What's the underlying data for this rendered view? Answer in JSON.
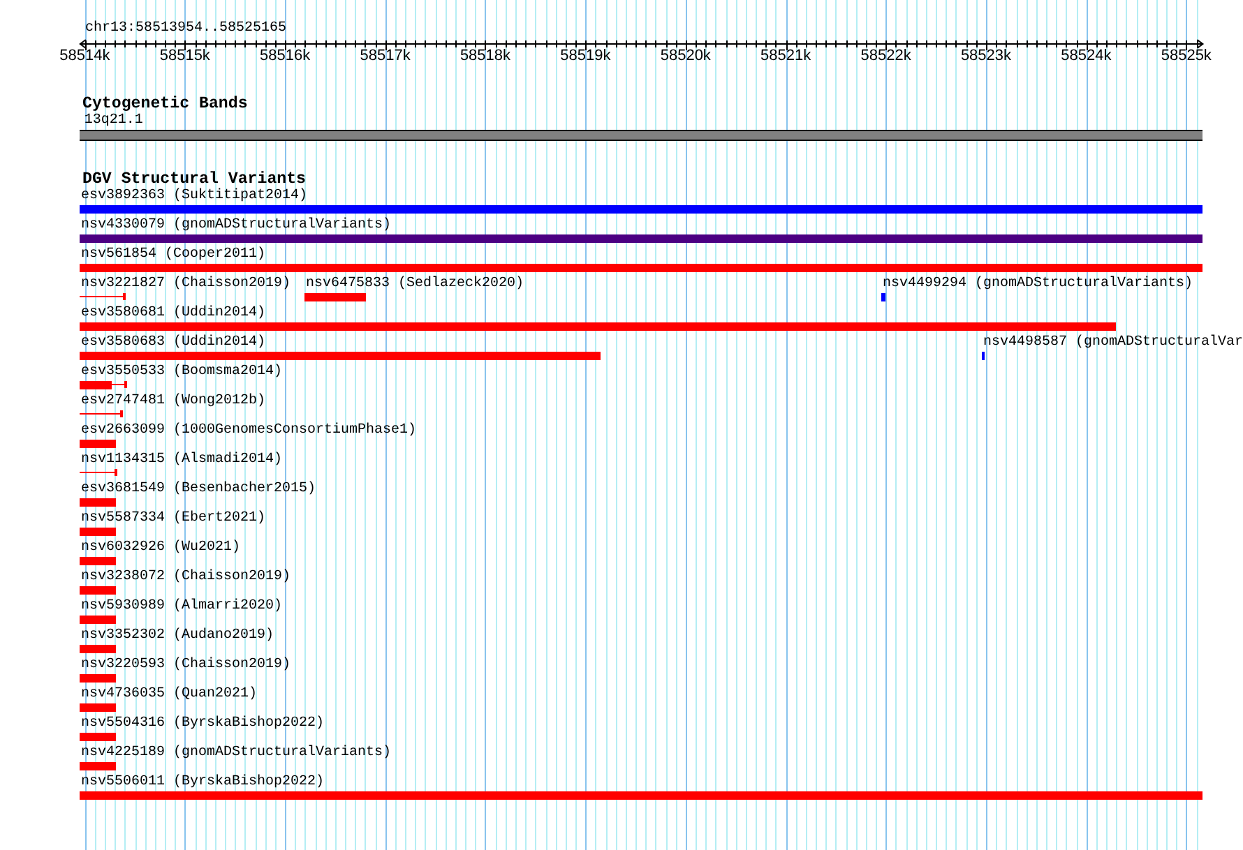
{
  "ruler": {
    "location": "chr13:58513954..58525165",
    "ticks": [
      {
        "label": "58514k"
      },
      {
        "label": "58515k"
      },
      {
        "label": "58516k"
      },
      {
        "label": "58517k"
      },
      {
        "label": "58518k"
      },
      {
        "label": "58519k"
      },
      {
        "label": "58520k"
      },
      {
        "label": "58521k"
      },
      {
        "label": "58522k"
      },
      {
        "label": "58523k"
      },
      {
        "label": "58524k"
      },
      {
        "label": "58525k"
      }
    ]
  },
  "cytogenetic_bands": {
    "title": "Cytogenetic Bands",
    "band": {
      "label": "13q21.1"
    }
  },
  "dgv_track": {
    "title": "DGV Structural Variants",
    "rows": [
      {
        "features": [
          {
            "label": "esv3892363 (Suktitipat2014)",
            "kind": "bar",
            "color": "#0000ff"
          }
        ]
      },
      {
        "features": [
          {
            "label": "nsv4330079 (gnomADStructuralVariants)",
            "kind": "bar",
            "color": "#4b0082"
          }
        ]
      },
      {
        "features": [
          {
            "label": "nsv561854 (Cooper2011)",
            "kind": "bar",
            "color": "#ff0000"
          }
        ]
      },
      {
        "features": [
          {
            "label": "nsv3221827 (Chaisson2019)",
            "kind": "line",
            "color": "#ff0000"
          },
          {
            "label": "nsv6475833 (Sedlazeck2020)",
            "kind": "bar",
            "color": "#ff0000"
          },
          {
            "label": "nsv4499294 (gnomADStructuralVariants)",
            "kind": "bar",
            "color": "#0000ff"
          }
        ]
      },
      {
        "features": [
          {
            "label": "esv3580681 (Uddin2014)",
            "kind": "bar",
            "color": "#ff0000"
          }
        ]
      },
      {
        "features": [
          {
            "label": "esv3580683 (Uddin2014)",
            "kind": "bar",
            "color": "#ff0000"
          },
          {
            "label": "nsv4498587 (gnomADStructuralVar",
            "kind": "bar",
            "color": "#0000ff"
          }
        ]
      },
      {
        "features": [
          {
            "label": "esv3550533 (Boomsma2014)",
            "kind": "bar-line",
            "color": "#ff0000"
          }
        ]
      },
      {
        "features": [
          {
            "label": "esv2747481 (Wong2012b)",
            "kind": "line",
            "color": "#ff0000"
          }
        ]
      },
      {
        "features": [
          {
            "label": "esv2663099 (1000GenomesConsortiumPhase1)",
            "kind": "bar",
            "color": "#ff0000"
          }
        ]
      },
      {
        "features": [
          {
            "label": "nsv1134315 (Alsmadi2014)",
            "kind": "line",
            "color": "#ff0000"
          }
        ]
      },
      {
        "features": [
          {
            "label": "esv3681549 (Besenbacher2015)",
            "kind": "bar",
            "color": "#ff0000"
          }
        ]
      },
      {
        "features": [
          {
            "label": "nsv5587334 (Ebert2021)",
            "kind": "bar",
            "color": "#ff0000"
          }
        ]
      },
      {
        "features": [
          {
            "label": "nsv6032926 (Wu2021)",
            "kind": "bar",
            "color": "#ff0000"
          }
        ]
      },
      {
        "features": [
          {
            "label": "nsv3238072 (Chaisson2019)",
            "kind": "bar",
            "color": "#ff0000"
          }
        ]
      },
      {
        "features": [
          {
            "label": "nsv5930989 (Almarri2020)",
            "kind": "bar",
            "color": "#ff0000"
          }
        ]
      },
      {
        "features": [
          {
            "label": "nsv3352302 (Audano2019)",
            "kind": "bar",
            "color": "#ff0000"
          }
        ]
      },
      {
        "features": [
          {
            "label": "nsv3220593 (Chaisson2019)",
            "kind": "bar",
            "color": "#ff0000"
          }
        ]
      },
      {
        "features": [
          {
            "label": "nsv4736035 (Quan2021)",
            "kind": "bar",
            "color": "#ff0000"
          }
        ]
      },
      {
        "features": [
          {
            "label": "nsv5504316 (ByrskaBishop2022)",
            "kind": "bar",
            "color": "#ff0000"
          }
        ]
      },
      {
        "features": [
          {
            "label": "nsv4225189 (gnomADStructuralVariants)",
            "kind": "bar",
            "color": "#ff0000"
          }
        ]
      },
      {
        "features": [
          {
            "label": "nsv5506011 (ByrskaBishop2022)",
            "kind": "bar",
            "color": "#ff0000"
          }
        ]
      }
    ]
  }
}
